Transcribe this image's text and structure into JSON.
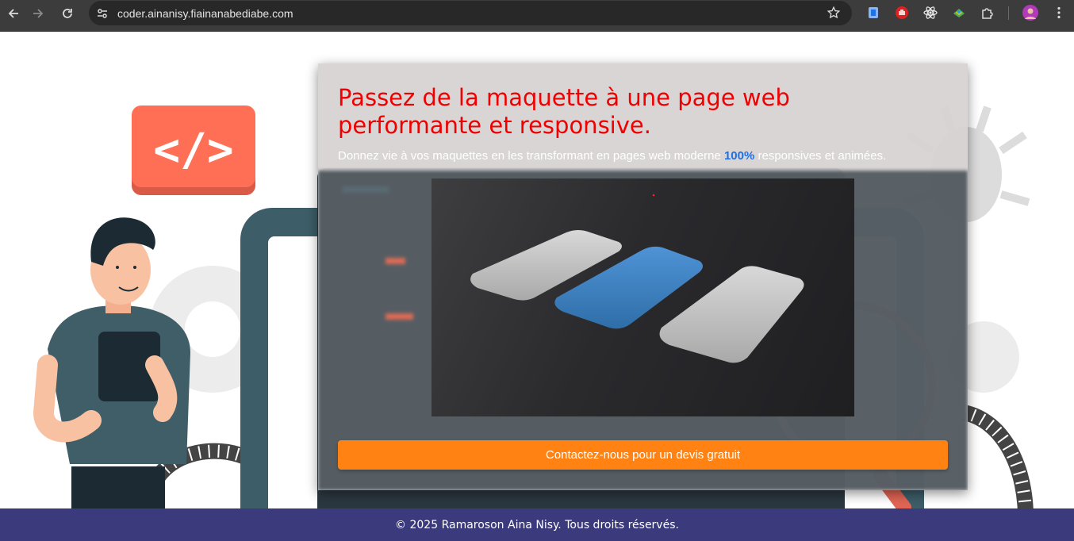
{
  "browser": {
    "url": "coder.ainanisy.fiainanabediabe.com",
    "back_icon": "arrow-left-icon",
    "forward_icon": "arrow-right-icon",
    "reload_icon": "reload-icon"
  },
  "hero": {
    "title": "Passez de la maquette à une page web performante et responsive.",
    "subtitle_before": "Donnez vie à vos maquettes en les transformant en pages web moderne ",
    "subtitle_highlight": "100%",
    "subtitle_after": " responsives et animées.",
    "cta_label": "Contactez-nous pour un devis gratuit"
  },
  "illustration": {
    "code_badge": "</>"
  },
  "footer": {
    "text": "© 2025 Ramaroson Aina Nisy. Tous droits réservés."
  },
  "colors": {
    "title": "#f00000",
    "highlight": "#1e6fe8",
    "cta": "#ff8212",
    "footer": "#3a3a7c",
    "code_badge": "#ff6f55"
  }
}
